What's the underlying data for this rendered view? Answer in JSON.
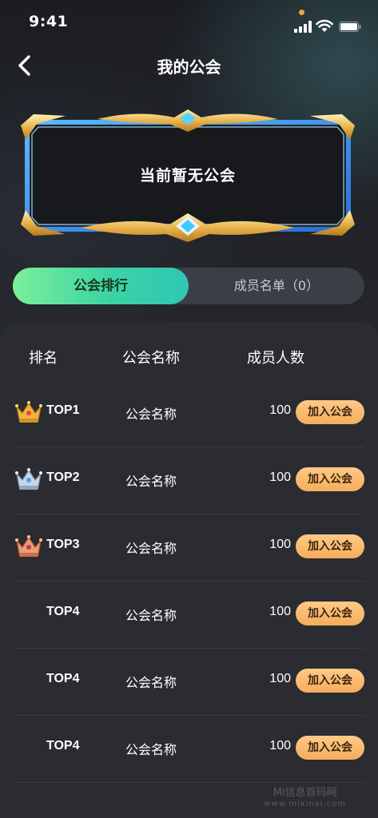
{
  "status_bar": {
    "time": "9:41",
    "icons": [
      "signal-icon",
      "wifi-icon",
      "battery-icon"
    ],
    "notification_dot_color": "#f5a23a"
  },
  "nav": {
    "title": "我的公会",
    "back_icon": "chevron-left-icon"
  },
  "banner": {
    "text": "当前暂无公会"
  },
  "tabs": [
    {
      "label": "公会排行",
      "active": true
    },
    {
      "label": "成员名单（0）",
      "active": false
    }
  ],
  "table": {
    "headers": {
      "rank": "排名",
      "name": "公会名称",
      "count": "成员人数"
    },
    "rows": [
      {
        "rank": "TOP1",
        "crown": "gold-crown-icon",
        "name": "公会名称",
        "count": "100",
        "action": "加入公会"
      },
      {
        "rank": "TOP2",
        "crown": "silver-crown-icon",
        "name": "公会名称",
        "count": "100",
        "action": "加入公会"
      },
      {
        "rank": "TOP3",
        "crown": "bronze-crown-icon",
        "name": "公会名称",
        "count": "100",
        "action": "加入公会"
      },
      {
        "rank": "TOP4",
        "crown": "",
        "name": "公会名称",
        "count": "100",
        "action": "加入公会"
      },
      {
        "rank": "TOP4",
        "crown": "",
        "name": "公会名称",
        "count": "100",
        "action": "加入公会"
      },
      {
        "rank": "TOP4",
        "crown": "",
        "name": "公会名称",
        "count": "100",
        "action": "加入公会"
      }
    ]
  },
  "colors": {
    "accent_green": "#3bd3a4",
    "join_button": "#f5ad5c",
    "gold": "#e9b44c",
    "silver": "#b9c6d6",
    "bronze": "#e98c6a"
  },
  "watermark": {
    "title": "Mi信息首码网",
    "url": "www.mixinxi.com"
  }
}
